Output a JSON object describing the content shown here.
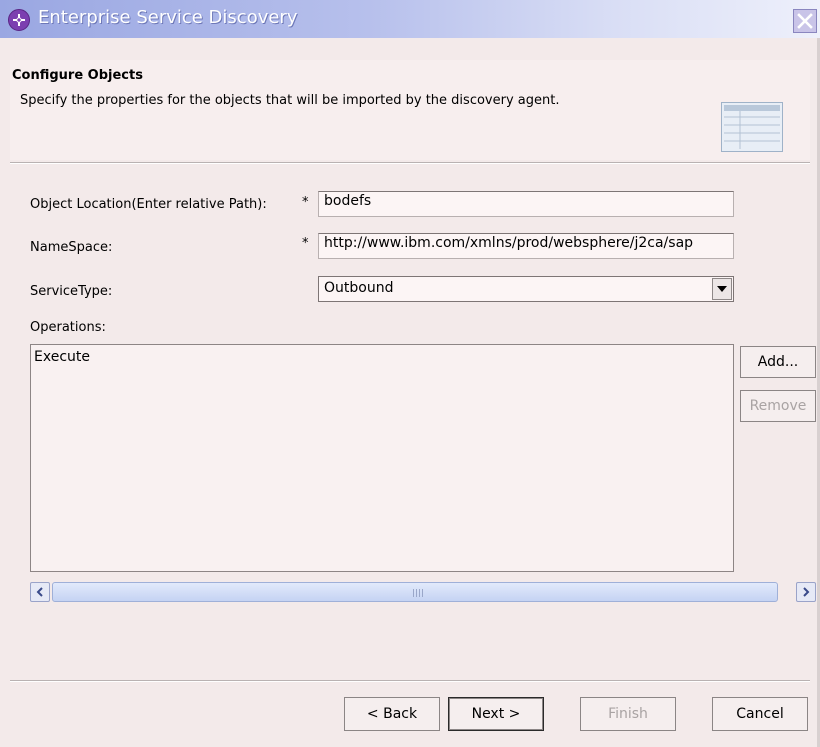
{
  "window": {
    "title": "Enterprise Service Discovery",
    "app_icon": "eclipse-plugin-icon",
    "close_icon": "close-icon"
  },
  "header": {
    "title": "Configure Objects",
    "description": "Specify the properties for the objects that will be imported by the discovery agent.",
    "banner_icon": "wizard-table-icon"
  },
  "form": {
    "object_location": {
      "label": "Object Location(Enter relative Path):",
      "required_mark": "*",
      "value": "bodefs"
    },
    "namespace": {
      "label": "NameSpace:",
      "required_mark": "*",
      "value": "http://www.ibm.com/xmlns/prod/websphere/j2ca/sap"
    },
    "service_type": {
      "label": "ServiceType:",
      "value": "Outbound",
      "dropdown_icon": "chevron-down-icon"
    },
    "operations": {
      "label": "Operations:",
      "items": [
        "Execute"
      ],
      "add_label": "Add...",
      "remove_label": "Remove"
    }
  },
  "footer": {
    "back_label": "< Back",
    "next_label": "Next >",
    "finish_label": "Finish",
    "cancel_label": "Cancel"
  },
  "colors": {
    "title_gradient_start": "#9aa7e2",
    "dialog_bg": "#f3eaea",
    "disabled_text": "#a9a3a3"
  }
}
